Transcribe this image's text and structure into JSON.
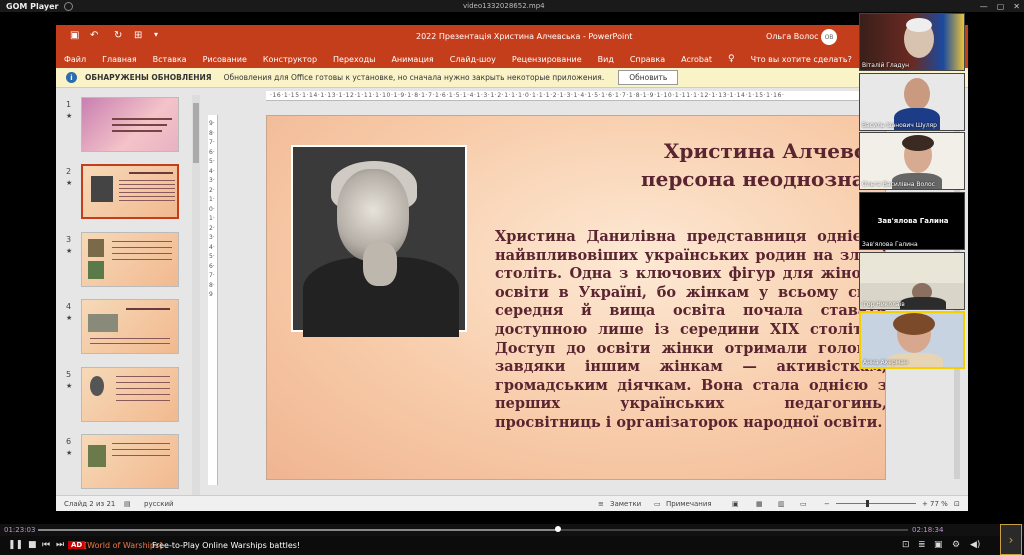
{
  "player": {
    "app_name": "GOM Player",
    "file_name": "video1332028652.mp4",
    "time_current": "01:23:03",
    "time_total": "02:18:34",
    "progress_fraction": 0.598,
    "ad_badge": "AD",
    "ad_title": "[World of Warships]",
    "ad_text": "Free-to-Play Online Warships battles!",
    "window_controls": [
      "—",
      "▢",
      "✕"
    ]
  },
  "powerpoint": {
    "title": "2022 Презентація Христина Алчевська  -  PowerPoint",
    "user_name": "Ольга Волос",
    "user_initials": "ОВ",
    "tabs": [
      "Файл",
      "Главная",
      "Вставка",
      "Рисование",
      "Конструктор",
      "Переходы",
      "Анимация",
      "Слайд-шоу",
      "Рецензирование",
      "Вид",
      "Справка",
      "Acrobat"
    ],
    "tell_me": "Что вы хотите сделать?",
    "infobar": {
      "heading": "ОБНАРУЖЕНЫ ОБНОВЛЕНИЯ",
      "text": "Обновления для Office готовы к установке, но сначала нужно закрыть некоторые приложения.",
      "button": "Обновить"
    },
    "thumbnails": [
      {
        "num": "1"
      },
      {
        "num": "2",
        "selected": true
      },
      {
        "num": "3"
      },
      {
        "num": "4"
      },
      {
        "num": "5"
      },
      {
        "num": "6"
      }
    ],
    "hruler_labels": "·16·1·15·1·14·1·13·1·12·1·11·1·10·1·9·1·8·1·7·1·6·1·5·1·4·1·3·1·2·1·1·1·0·1·1·1·2·1·3·1·4·1·5·1·6·1·7·1·8·1·9·1·10·1·11·1·12·1·13·1·14·1·15·1·16·",
    "vruler_labels": "9·8·7·6·5·4·3·2·1·0·1·2·3·4·5·6·7·8·9",
    "slide": {
      "title": "Христина Алчевська\nперсона неоднозначна",
      "body": "Христина Данилівна представниця однієї з найвпливовіших українських родин на зламі століть. Одна з ключових фігур для жіночої освіти в Україні, бо жінкам у всьому світі середня й вища освіта почала ставати доступною лише із середини XIX століття. Доступ до освіти жінки отримали головно завдяки іншим жінкам — активісткам, громадським діячкам. Вона стала однією з перших українських педагогинь, просвітниць і організаторок народної освіти."
    },
    "status": {
      "slide_of": "Слайд 2 из 21",
      "language": "русский",
      "notes": "Заметки",
      "comments": "Примечания",
      "zoom": "77 %"
    }
  },
  "participants": [
    {
      "name": "Віталій Гладун"
    },
    {
      "name": "Василь Іванович Шуляр"
    },
    {
      "name": "Ольга Василівна Волос"
    },
    {
      "name": "Зав'ялова Галина",
      "label_center": "Зав'ялова Галина"
    },
    {
      "name": "Ігор Николаїв"
    },
    {
      "name": "Анна Акерман"
    }
  ]
}
